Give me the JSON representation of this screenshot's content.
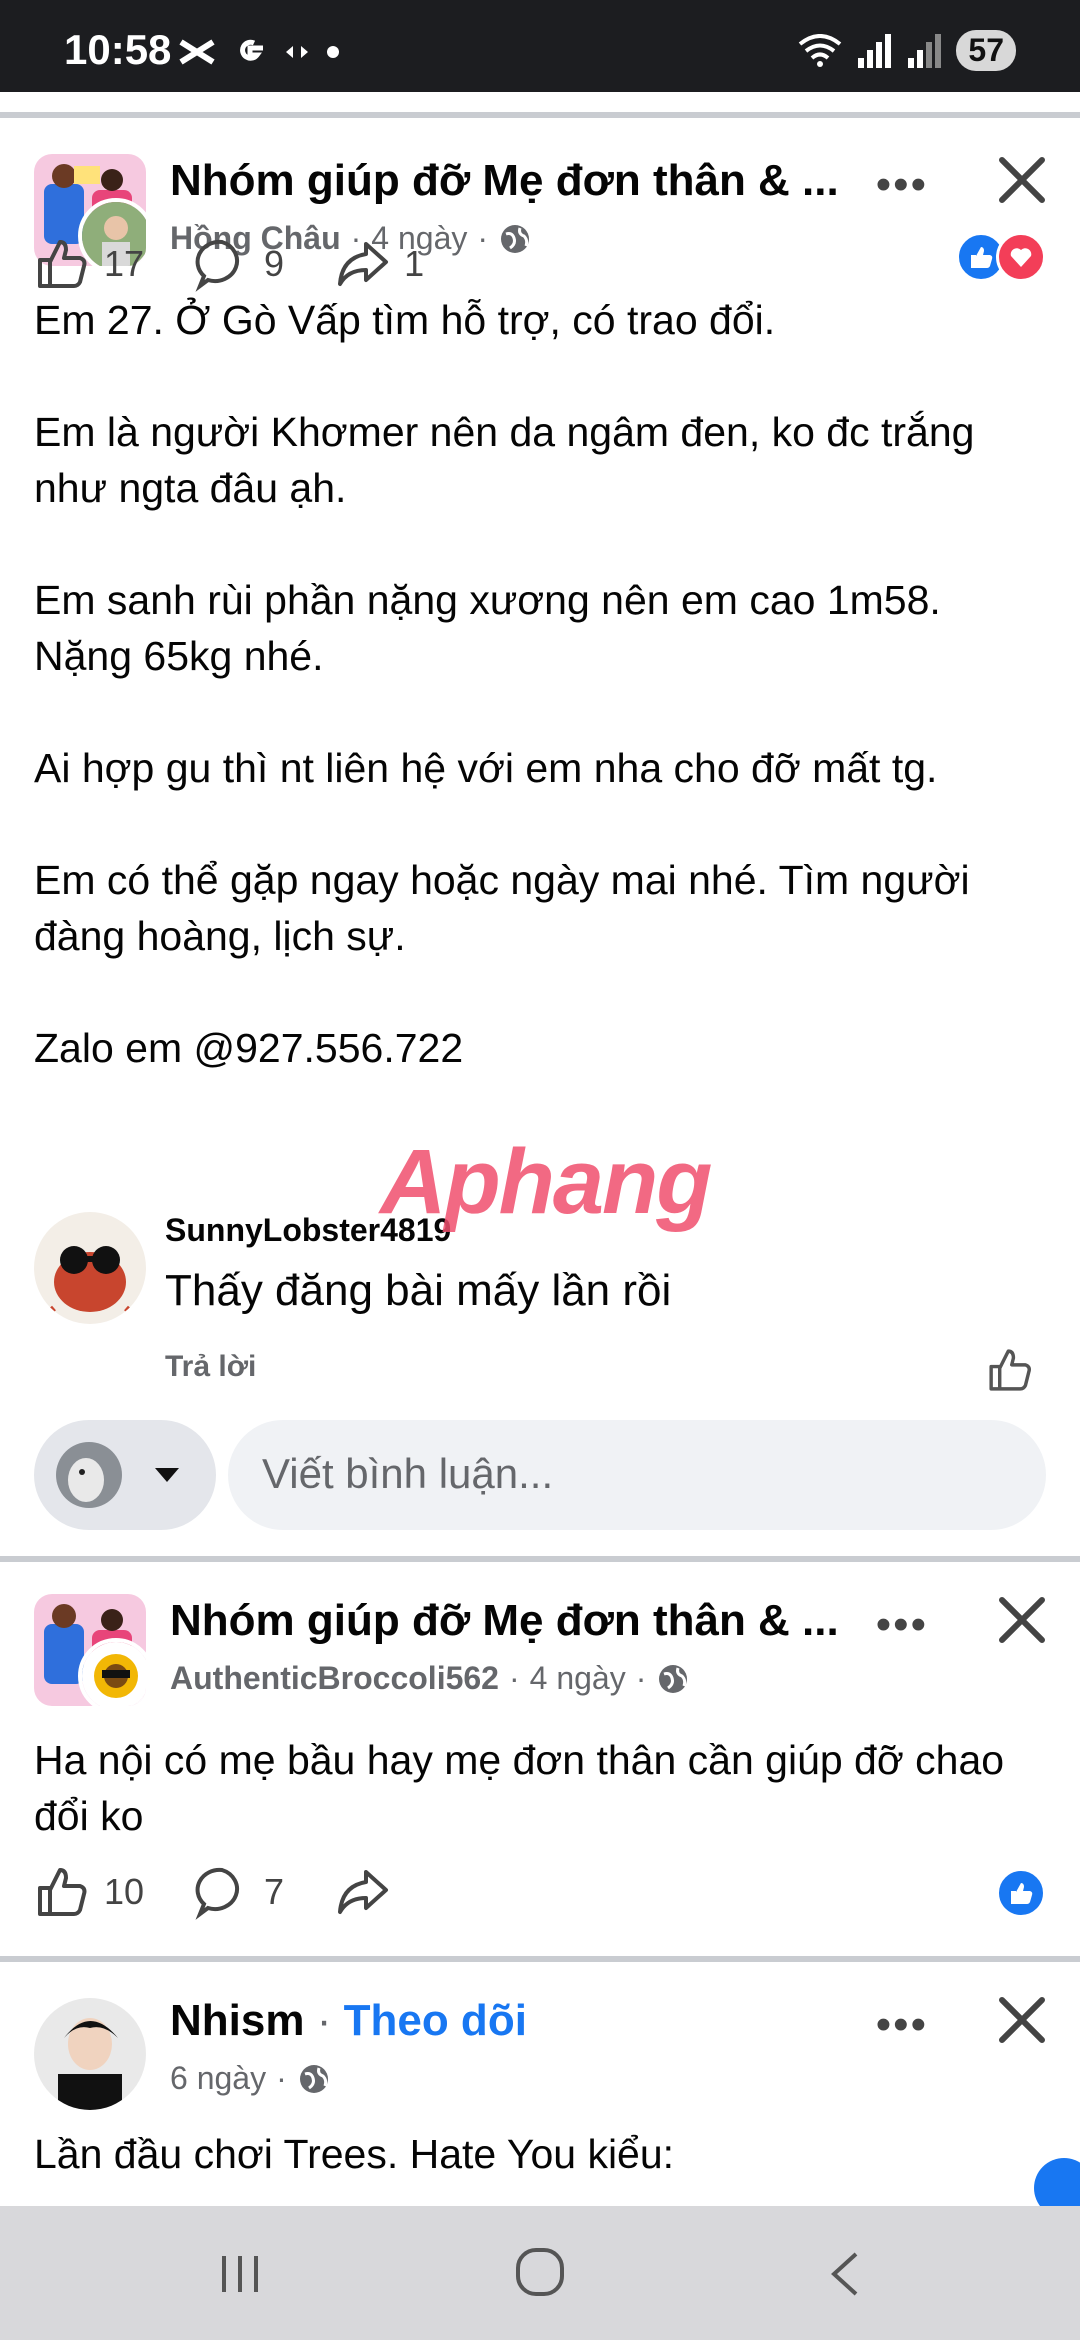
{
  "status_bar": {
    "time": "10:58",
    "battery": "57"
  },
  "posts": [
    {
      "group": "Nhóm giúp đỡ Mẹ đơn thân & ...",
      "author": "Hồng Châu",
      "time": "4 ngày",
      "body": "Em 27. Ở Gò Vấp tìm hỗ trợ, có trao đổi.\n\nEm là người Khơmer nên da ngâm đen, ko đc trắng như ngta đâu ạh.\n\nEm sanh rùi phần nặng xương nên em cao 1m58. Nặng 65kg nhé.\n\nAi hợp gu thì nt liên hệ với em nha cho đỡ mất tg.\n\nEm có thể gặp ngay hoặc ngày mai nhé. Tìm người đàng hoàng, lịch sự.\n\nZalo em @927.556.722",
      "likes": "17",
      "comments": "9",
      "shares": "1",
      "comment": {
        "author": "SunnyLobster4819",
        "text": "Thấy đăng bài mấy lần rồi",
        "reply_label": "Trả lời"
      },
      "composer_placeholder": "Viết bình luận..."
    },
    {
      "group": "Nhóm giúp đỡ Mẹ đơn thân & ...",
      "author": "AuthenticBroccoli562",
      "time": "4 ngày",
      "body": "Ha nội có mẹ bầu hay mẹ đơn thân cần giúp đỡ chao đổi ko",
      "likes": "10",
      "comments": "7"
    },
    {
      "author": "Nhism",
      "follow_label": "Theo dõi",
      "time": "6 ngày",
      "body": "Lần đầu chơi Trees. Hate You kiểu:"
    }
  ],
  "watermark": "Aphang",
  "colors": {
    "accent": "#1877f2",
    "love": "#f33e58",
    "watermark": "#f0506e"
  }
}
